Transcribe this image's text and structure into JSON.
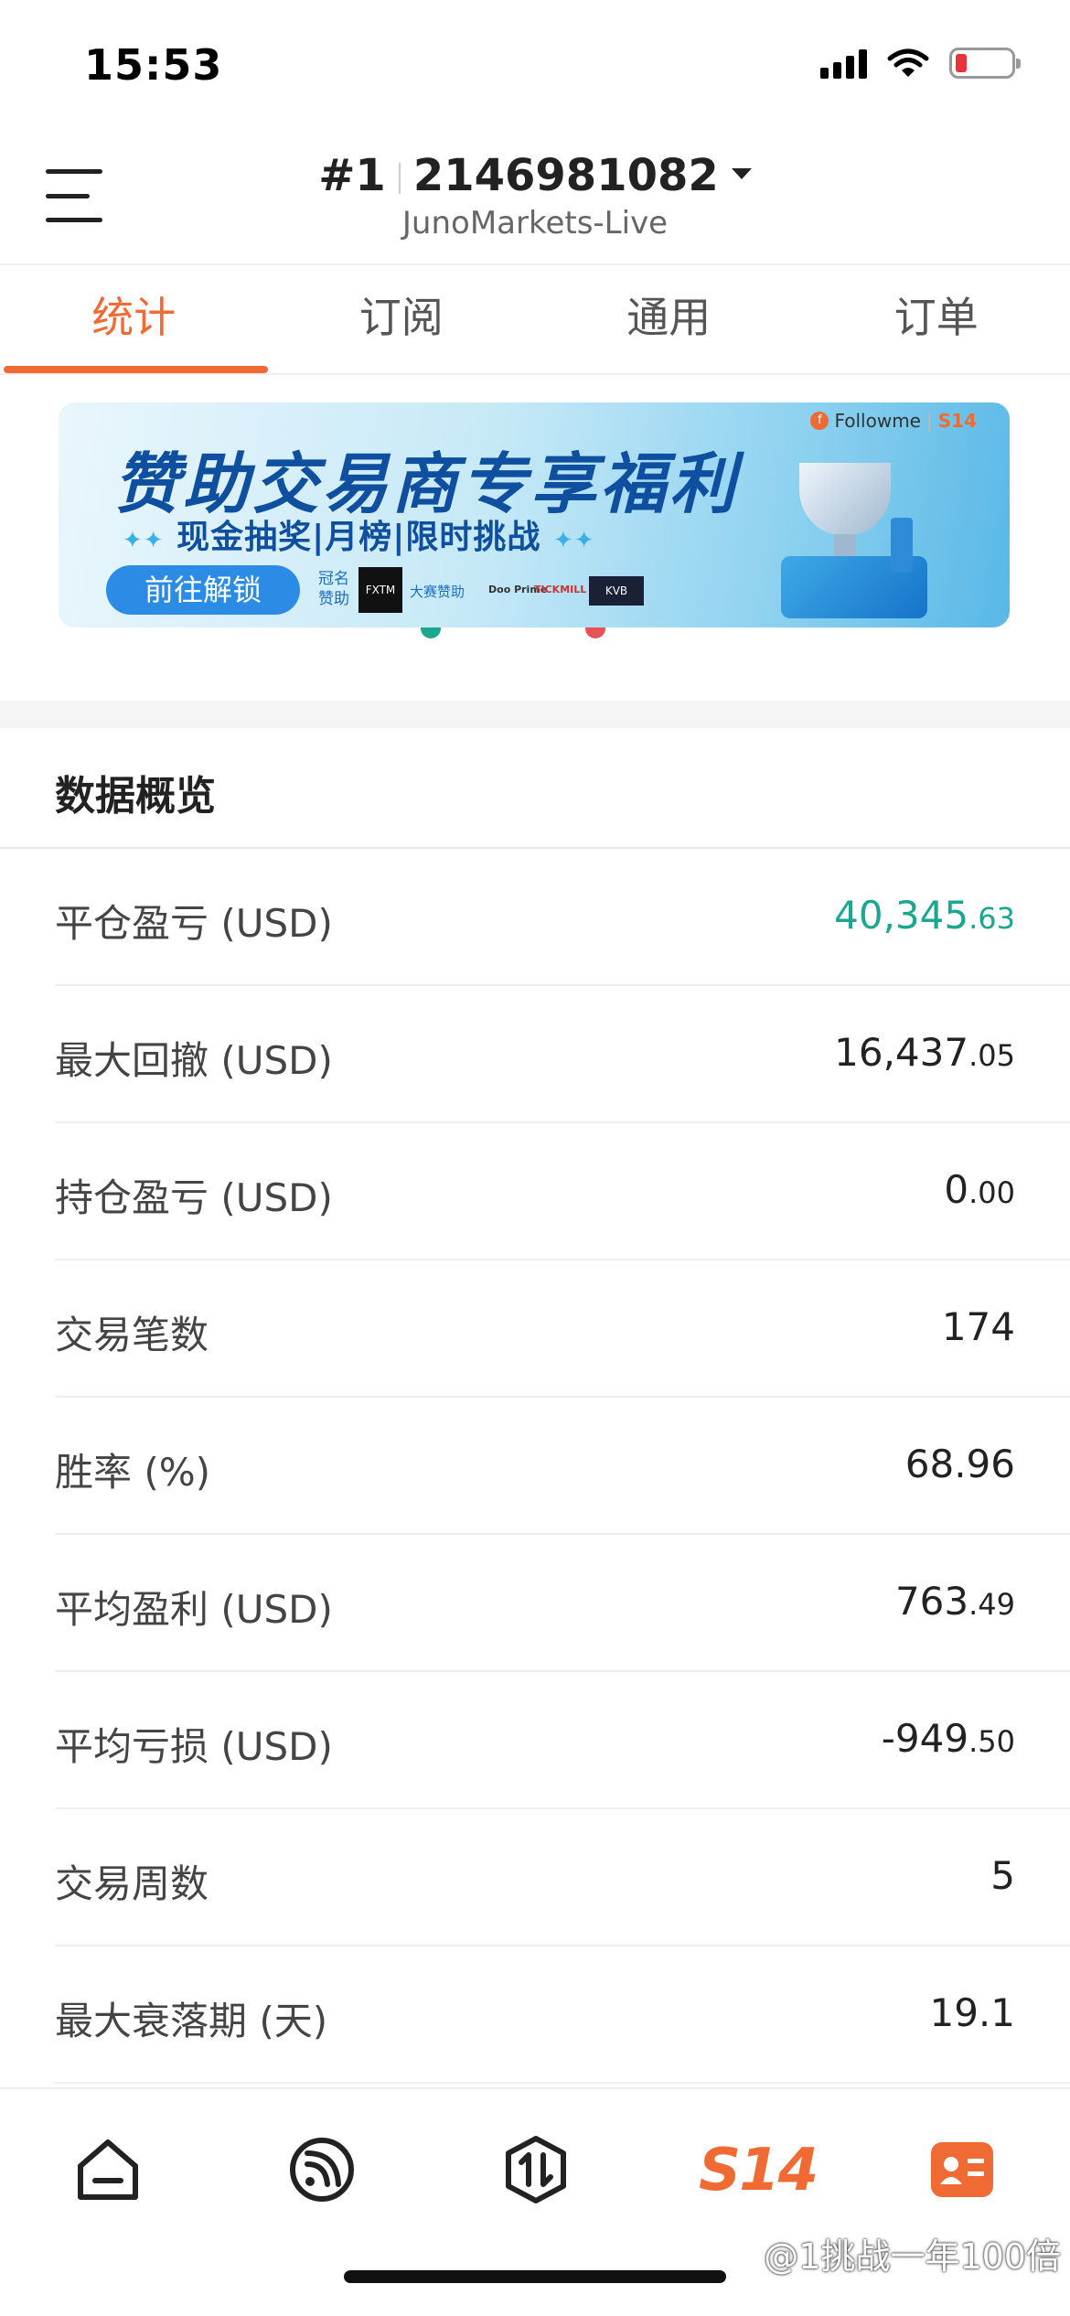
{
  "status_bar": {
    "time": "15:53"
  },
  "header": {
    "account_prefix": "#1",
    "account_number": "2146981082",
    "server": "JunoMarkets-Live"
  },
  "tabs": [
    {
      "label": "统计",
      "active": true
    },
    {
      "label": "订阅",
      "active": false
    },
    {
      "label": "通用",
      "active": false
    },
    {
      "label": "订单",
      "active": false
    }
  ],
  "banner": {
    "title": "赞助交易商专享福利",
    "subtitle": "现金抽奖|月榜|限时挑战",
    "cta": "前往解锁",
    "sponsor_label": "冠名赞助",
    "sponsor_logo": "FXTM 富拓",
    "sponsor_text": "大赛赞助",
    "sponsor_2": "Doo Prime",
    "sponsor_3": "TICKMILL",
    "sponsor_4": "KVB",
    "brand": "Followme",
    "brand_badge": "S14"
  },
  "overview": {
    "title": "数据概览",
    "rows": [
      {
        "label": "平仓盈亏 (USD)",
        "int": "40,345",
        "dec": ".63",
        "color": "#1aa68f"
      },
      {
        "label": "最大回撤 (USD)",
        "int": "16,437",
        "dec": ".05"
      },
      {
        "label": "持仓盈亏 (USD)",
        "int": "0",
        "dec": ".00"
      },
      {
        "label": "交易笔数",
        "int": "174",
        "dec": ""
      },
      {
        "label": "胜率 (%)",
        "int": "68.96",
        "dec": ""
      },
      {
        "label": "平均盈利 (USD)",
        "int": "763",
        "dec": ".49"
      },
      {
        "label": "平均亏损 (USD)",
        "int": "-949",
        "dec": ".50"
      },
      {
        "label": "交易周数",
        "int": "5",
        "dec": ""
      },
      {
        "label": "最大衰落期 (天)",
        "int": "19.1",
        "dec": ""
      }
    ]
  },
  "bottom_nav": {
    "items": [
      "home-icon",
      "feed-icon",
      "trade-icon",
      "s14-icon",
      "profile-card-icon"
    ],
    "s14_label": "S14"
  },
  "watermark": "@1挑战一年100倍",
  "colors": {
    "accent": "#f06a34",
    "positive": "#1aa68f"
  }
}
